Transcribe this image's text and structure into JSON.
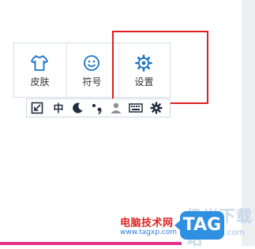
{
  "panel": {
    "items": [
      {
        "label": "皮肤",
        "icon": "shirt-icon"
      },
      {
        "label": "符号",
        "icon": "smiley-icon"
      },
      {
        "label": "设置",
        "icon": "gear-icon"
      }
    ]
  },
  "toolbar": {
    "mode_char": "中",
    "buttons": [
      {
        "icon": "expand-arrow-icon"
      },
      {
        "icon": "chinese-mode-icon"
      },
      {
        "icon": "moon-icon"
      },
      {
        "icon": "punctuation-icon"
      },
      {
        "icon": "user-icon"
      },
      {
        "icon": "keyboard-icon"
      },
      {
        "icon": "gear-icon"
      }
    ]
  },
  "watermark": {
    "cn_text": "极光下载站",
    "site_name": "电脑技术网",
    "url": "www.tagxp.com",
    "tag": "TAG",
    "dotcom": ".com"
  },
  "colors": {
    "icon_blue": "#1c74c4",
    "highlight_red": "#e01e1e",
    "accent_pink": "#e3348a",
    "tag_blue": "#2f8fe0"
  }
}
